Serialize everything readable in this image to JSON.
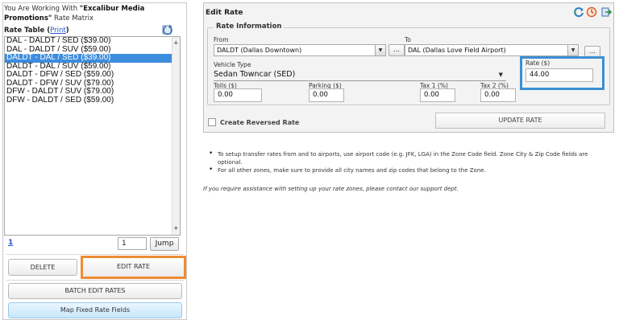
{
  "left": {
    "working_prefix": "You Are Working With ",
    "company": "\"Excalibur Media Promotions\"",
    "matrix_suffix": " Rate Matrix",
    "rate_table_label": "Rate Table (",
    "print_link": "Print",
    "rate_table_close": ")",
    "rates": [
      "DAL - DALDT / SED ($39.00)",
      "DAL - DALDT / SUV ($59.00)",
      "DALDT - DAL / SED ($39.00)",
      "DALDT - DAL / SUV ($59.00)",
      "DALDT - DFW / SED ($59.00)",
      "DALDT - DFW / SUV ($79.00)",
      "DFW - DALDT / SUV ($79.00)",
      "DFW - DALDT / SED ($59.00)"
    ],
    "selected_index": 2,
    "page_link": "1",
    "page_input": "1",
    "jump_label": "Jump",
    "delete_label": "DELETE",
    "edit_rate_label": "EDIT RATE",
    "batch_label": "BATCH EDIT RATES",
    "map_label": "Map Fixed Rate Fields"
  },
  "edit": {
    "title": "Edit Rate",
    "legend": "Rate Information",
    "from_label": "From",
    "from_value": "DALDT (Dallas Downtown)",
    "to_label": "To",
    "to_value": "DAL (Dallas Love Field Airport)",
    "dots": "...",
    "vehicle_label": "Vehicle Type",
    "vehicle_value": "Sedan Towncar (SED)",
    "rate_label": "Rate ($)",
    "rate_value": "44.00",
    "tolls_label": "Tolls ($)",
    "tolls_value": "0.00",
    "parking_label": "Parking ($)",
    "parking_value": "0.00",
    "tax1_label": "Tax 1 (%)",
    "tax1_value": "0.00",
    "tax2_label": "Tax 2 (%)",
    "tax2_value": "0.00",
    "reverse_label": "Create Reversed Rate",
    "update_label": "UPDATE RATE"
  },
  "notes": {
    "bullet1": "To setup transfer rates from and to airports, use airport code (e.g. JFK, LGA) in the Zone Code field. Zone City & Zip Code fields are optional.",
    "bullet2": "For all other zones, make sure to provide all city names and zip codes that belong to the Zone.",
    "support": "If you require assistance with setting up your rate zones, please contact our support dept."
  },
  "colors": {
    "selected_row": "#3c8dde",
    "edit_highlight": "#ef8b33",
    "rate_highlight": "#3a8fd3"
  }
}
